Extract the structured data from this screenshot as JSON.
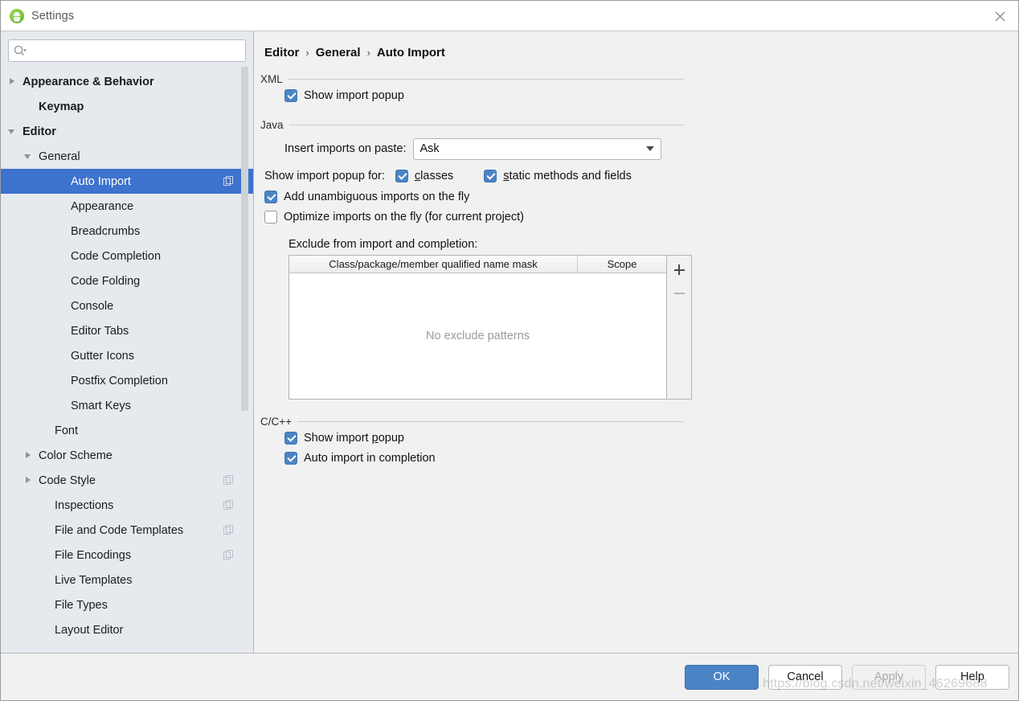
{
  "window": {
    "title": "Settings",
    "app_icon": "android-studio-icon",
    "close_icon": "close-icon"
  },
  "search": {
    "icon": "search-icon",
    "value": "",
    "placeholder": ""
  },
  "sidebar": {
    "items": [
      {
        "label": "Appearance & Behavior",
        "indent": 1,
        "twisty": "right",
        "bold": true,
        "selected": false,
        "copy_icon": false
      },
      {
        "label": "Keymap",
        "indent": 2,
        "twisty": "none",
        "bold": true,
        "selected": false,
        "copy_icon": false
      },
      {
        "label": "Editor",
        "indent": 1,
        "twisty": "down",
        "bold": true,
        "selected": false,
        "copy_icon": false
      },
      {
        "label": "General",
        "indent": 2,
        "twisty": "down",
        "bold": false,
        "selected": false,
        "copy_icon": false
      },
      {
        "label": "Auto Import",
        "indent": 4,
        "twisty": "none",
        "bold": false,
        "selected": true,
        "copy_icon": true
      },
      {
        "label": "Appearance",
        "indent": 4,
        "twisty": "none",
        "bold": false,
        "selected": false,
        "copy_icon": false
      },
      {
        "label": "Breadcrumbs",
        "indent": 4,
        "twisty": "none",
        "bold": false,
        "selected": false,
        "copy_icon": false
      },
      {
        "label": "Code Completion",
        "indent": 4,
        "twisty": "none",
        "bold": false,
        "selected": false,
        "copy_icon": false
      },
      {
        "label": "Code Folding",
        "indent": 4,
        "twisty": "none",
        "bold": false,
        "selected": false,
        "copy_icon": false
      },
      {
        "label": "Console",
        "indent": 4,
        "twisty": "none",
        "bold": false,
        "selected": false,
        "copy_icon": false
      },
      {
        "label": "Editor Tabs",
        "indent": 4,
        "twisty": "none",
        "bold": false,
        "selected": false,
        "copy_icon": false
      },
      {
        "label": "Gutter Icons",
        "indent": 4,
        "twisty": "none",
        "bold": false,
        "selected": false,
        "copy_icon": false
      },
      {
        "label": "Postfix Completion",
        "indent": 4,
        "twisty": "none",
        "bold": false,
        "selected": false,
        "copy_icon": false
      },
      {
        "label": "Smart Keys",
        "indent": 4,
        "twisty": "none",
        "bold": false,
        "selected": false,
        "copy_icon": false
      },
      {
        "label": "Font",
        "indent": 3,
        "twisty": "none",
        "bold": false,
        "selected": false,
        "copy_icon": false
      },
      {
        "label": "Color Scheme",
        "indent": 2,
        "twisty": "right",
        "bold": false,
        "selected": false,
        "copy_icon": false
      },
      {
        "label": "Code Style",
        "indent": 2,
        "twisty": "right",
        "bold": false,
        "selected": false,
        "copy_icon": true
      },
      {
        "label": "Inspections",
        "indent": 3,
        "twisty": "none",
        "bold": false,
        "selected": false,
        "copy_icon": true
      },
      {
        "label": "File and Code Templates",
        "indent": 3,
        "twisty": "none",
        "bold": false,
        "selected": false,
        "copy_icon": true
      },
      {
        "label": "File Encodings",
        "indent": 3,
        "twisty": "none",
        "bold": false,
        "selected": false,
        "copy_icon": true
      },
      {
        "label": "Live Templates",
        "indent": 3,
        "twisty": "none",
        "bold": false,
        "selected": false,
        "copy_icon": false
      },
      {
        "label": "File Types",
        "indent": 3,
        "twisty": "none",
        "bold": false,
        "selected": false,
        "copy_icon": false
      },
      {
        "label": "Layout Editor",
        "indent": 3,
        "twisty": "none",
        "bold": false,
        "selected": false,
        "copy_icon": false
      }
    ],
    "selected_color": "#3d72cd",
    "background": "#e6eaee"
  },
  "breadcrumb": {
    "crumb1": "Editor",
    "crumb2": "General",
    "crumb3": "Auto Import",
    "separator": "›"
  },
  "xml_section": {
    "title": "XML",
    "show_import_popup": {
      "label": "Show import popup",
      "checked": true
    }
  },
  "java_section": {
    "title": "Java",
    "insert_imports_label": "Insert imports on paste:",
    "insert_imports_value": "Ask",
    "insert_imports_options": [
      "Ask"
    ],
    "show_popup_for_label": "Show import popup for:",
    "classes": {
      "label": "classes",
      "mnemonic": "c",
      "rest": "lasses",
      "checked": true
    },
    "static_members": {
      "label": "static methods and fields",
      "mnemonic": "s",
      "rest": "tatic methods and fields",
      "checked": true
    },
    "add_unambiguous": {
      "label": "Add unambiguous imports on the fly",
      "checked": true
    },
    "optimize_imports": {
      "label": "Optimize imports on the fly (for current project)",
      "checked": false
    },
    "exclude_label": "Exclude from import and completion:",
    "table": {
      "columns": [
        "Class/package/member qualified name mask",
        "Scope"
      ],
      "rows": [],
      "empty_text": "No exclude patterns",
      "add_button": "+",
      "remove_button": "−"
    }
  },
  "cpp_section": {
    "title": "C/C++",
    "show_import_popup": {
      "label_pre": "Show import ",
      "mnemonic": "p",
      "label_post": "opup",
      "label": "Show import popup",
      "checked": true
    },
    "auto_import_in_completion": {
      "label": "Auto import in completion",
      "checked": true
    }
  },
  "footer": {
    "ok": "OK",
    "cancel": "Cancel",
    "apply": "Apply",
    "help": "Help",
    "apply_disabled": true,
    "primary_color": "#4b84c4"
  },
  "watermark": "https://blog.csdn.net/weixin_46269688"
}
